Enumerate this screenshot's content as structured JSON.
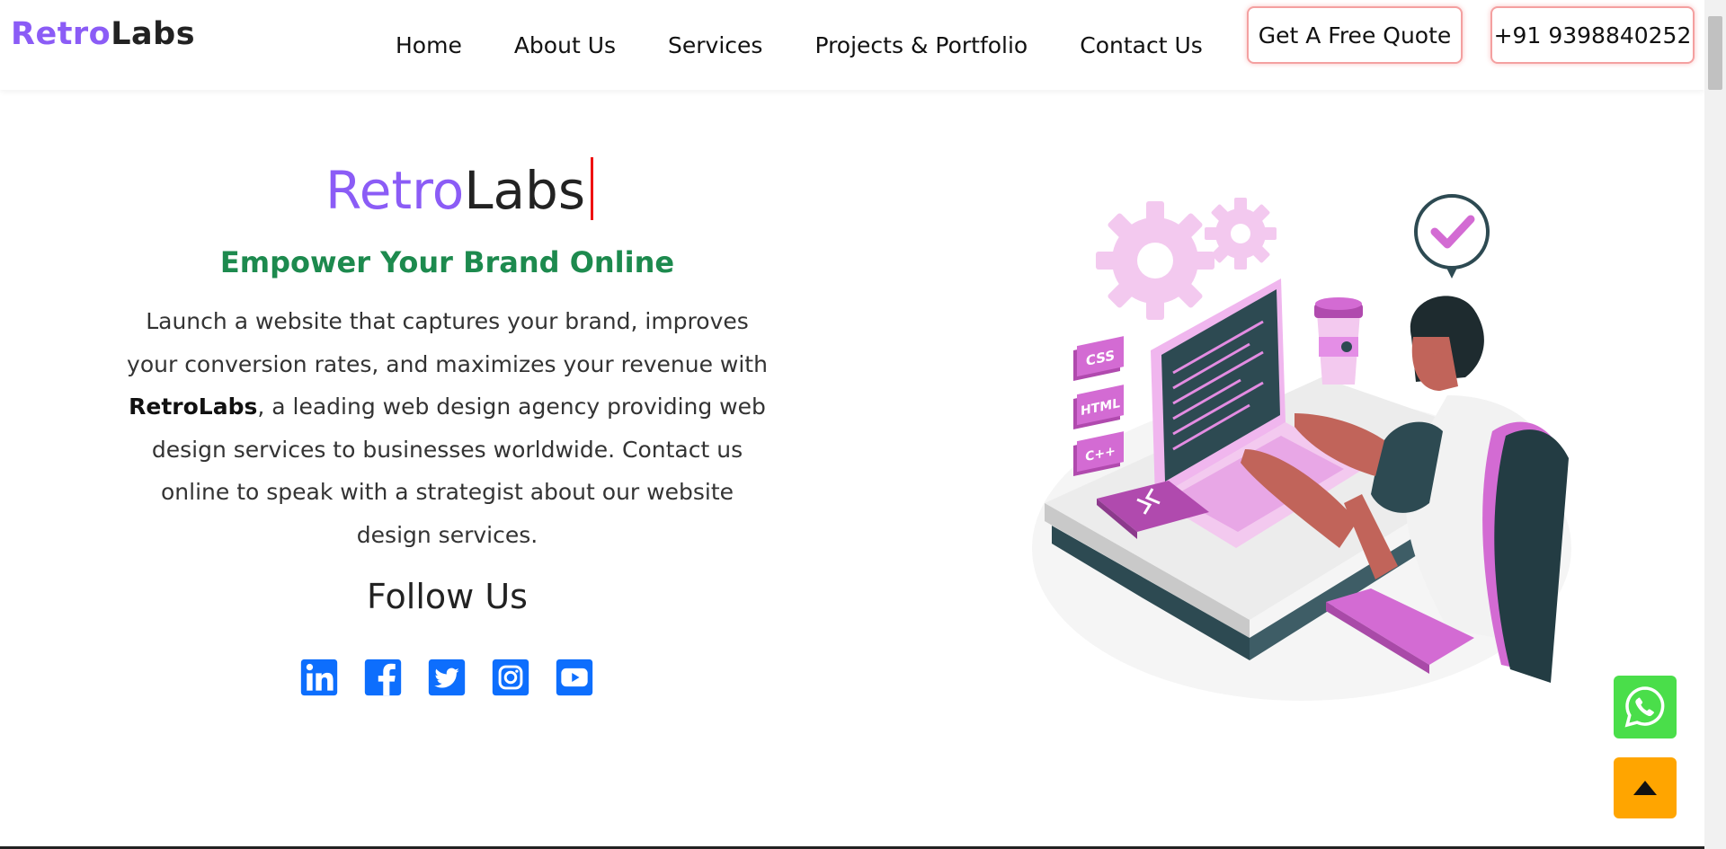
{
  "brand": {
    "part1": "Retro",
    "part2": "Labs"
  },
  "nav": {
    "links": [
      "Home",
      "About Us",
      "Services",
      "Projects & Portfolio",
      "Contact Us"
    ],
    "quote_label": "Get A Free Quote",
    "phone_label": "+91 9398840252"
  },
  "hero": {
    "title_part1": "Retro",
    "title_part2": "Labs",
    "tagline": "Empower Your Brand Online",
    "desc_before": "Launch a website that captures your brand, improves your conversion rates, and maximizes your revenue with ",
    "desc_bold": "RetroLabs",
    "desc_after": ", a leading web design agency providing web design services to businesses worldwide. Contact us online to speak with a strategist about our website design services.",
    "follow_title": "Follow Us"
  },
  "social": {
    "icons": [
      "linkedin-icon",
      "facebook-icon",
      "twitter-icon",
      "instagram-icon",
      "youtube-icon"
    ],
    "color": "#0d6efd"
  },
  "illustration": {
    "code_tags": [
      "CSS",
      "HTML",
      "C++"
    ]
  },
  "colors": {
    "brand_purple": "#8b5cf6",
    "tagline_green": "#1d8a4e",
    "whatsapp_green": "#4ade4a",
    "scroll_top_orange": "#ffa500",
    "illustration_pink": "#e48ee6"
  }
}
